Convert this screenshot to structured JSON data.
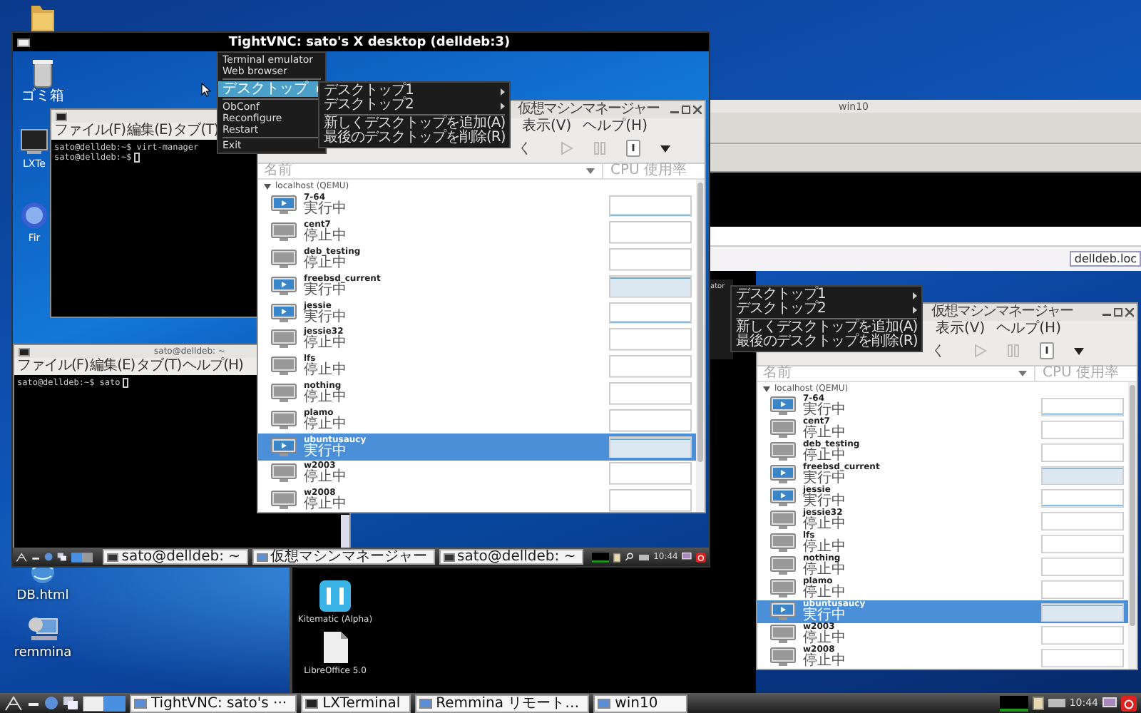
{
  "desktop_icons": [
    {
      "kind": "folder"
    },
    {
      "kind": "web",
      "label": "DB.html"
    },
    {
      "kind": "remote",
      "label": "remmina"
    }
  ],
  "win10_window": {
    "title": "win10",
    "address": "delldeb.loc"
  },
  "remote_view": {
    "icons": [
      {
        "kind": "kitematic",
        "label": "Kitematic (Alpha)"
      },
      {
        "kind": "document",
        "label": "LibreOffice 5.0"
      }
    ],
    "menu_fragment": "ator",
    "submenu": [
      {
        "kind": "submenu",
        "label": "デスクトップ1"
      },
      {
        "kind": "submenu",
        "label": "デスクトップ2"
      },
      {
        "kind": "separator"
      },
      {
        "kind": "item",
        "label": "新しくデスクトップを追加(A)"
      },
      {
        "kind": "item",
        "label": "最後のデスクトップを削除(R)"
      }
    ]
  },
  "vm_windows": [
    {
      "title": "仮想マシンマネージャー",
      "menu": [
        "表示(V)",
        "ヘルプ(H)"
      ],
      "toolbar_fragment": "く",
      "columns": [
        "名前",
        "CPU 使用率"
      ],
      "host": "localhost (QEMU)",
      "rows": [
        {
          "name": "7-64",
          "status": "実行中",
          "running": true,
          "kind": "line",
          "selected": false
        },
        {
          "name": "cent7",
          "status": "停止中",
          "running": false,
          "kind": "empty",
          "selected": false
        },
        {
          "name": "deb_testing",
          "status": "停止中",
          "running": false,
          "kind": "empty",
          "selected": false
        },
        {
          "name": "freebsd_current",
          "status": "実行中",
          "running": true,
          "kind": "filled",
          "selected": false
        },
        {
          "name": "jessie",
          "status": "実行中",
          "running": true,
          "kind": "line",
          "selected": false
        },
        {
          "name": "jessie32",
          "status": "停止中",
          "running": false,
          "kind": "empty",
          "selected": false
        },
        {
          "name": "lfs",
          "status": "停止中",
          "running": false,
          "kind": "empty",
          "selected": false
        },
        {
          "name": "nothing",
          "status": "停止中",
          "running": false,
          "kind": "empty",
          "selected": false
        },
        {
          "name": "plamo",
          "status": "停止中",
          "running": false,
          "kind": "empty",
          "selected": false
        },
        {
          "name": "ubuntusaucy",
          "status": "実行中",
          "running": true,
          "kind": "filled",
          "selected": true
        },
        {
          "name": "w2003",
          "status": "停止中",
          "running": false,
          "kind": "empty",
          "selected": false
        },
        {
          "name": "w2008",
          "status": "停止中",
          "running": false,
          "kind": "empty",
          "selected": false
        }
      ]
    },
    {
      "title": "仮想マシンマネージャー",
      "menu": [
        "表示(V)",
        "ヘルプ(H)"
      ],
      "toolbar_fragment": "く",
      "columns": [
        "名前",
        "CPU 使用率"
      ],
      "host": "localhost (QEMU)",
      "rows": [
        {
          "name": "7-64",
          "status": "実行中",
          "running": true,
          "kind": "line",
          "selected": false
        },
        {
          "name": "cent7",
          "status": "停止中",
          "running": false,
          "kind": "empty",
          "selected": false
        },
        {
          "name": "deb_testing",
          "status": "停止中",
          "running": false,
          "kind": "empty",
          "selected": false
        },
        {
          "name": "freebsd_current",
          "status": "実行中",
          "running": true,
          "kind": "filled",
          "selected": false
        },
        {
          "name": "jessie",
          "status": "実行中",
          "running": true,
          "kind": "line",
          "selected": false
        },
        {
          "name": "jessie32",
          "status": "停止中",
          "running": false,
          "kind": "empty",
          "selected": false
        },
        {
          "name": "lfs",
          "status": "停止中",
          "running": false,
          "kind": "empty",
          "selected": false
        },
        {
          "name": "nothing",
          "status": "停止中",
          "running": false,
          "kind": "empty",
          "selected": false
        },
        {
          "name": "plamo",
          "status": "停止中",
          "running": false,
          "kind": "empty",
          "selected": false
        },
        {
          "name": "ubuntusaucy",
          "status": "実行中",
          "running": true,
          "kind": "filled",
          "selected": true
        },
        {
          "name": "w2003",
          "status": "停止中",
          "running": false,
          "kind": "empty",
          "selected": false
        },
        {
          "name": "w2008",
          "status": "停止中",
          "running": false,
          "kind": "empty",
          "selected": false
        }
      ]
    }
  ],
  "vnc_window": {
    "title": "TightVNC: sato's X desktop (delldeb:3)",
    "desktop_icons": [
      {
        "kind": "trash",
        "label": "ゴミ箱"
      },
      {
        "kind": "terminal",
        "label": "LXTe"
      },
      {
        "kind": "browser",
        "label": "Fir"
      }
    ],
    "terminals": [
      {
        "menu": [
          "ファイル(F)",
          "編集(E)",
          "タブ(T)"
        ],
        "lines": [
          "sato@delldeb:~$ virt-manager",
          "sato@delldeb:~$"
        ]
      },
      {
        "title": "sato@delldeb: ~",
        "menu": [
          "ファイル(F)",
          "編集(E)",
          "タブ(T)",
          "ヘルプ(H)"
        ],
        "lines": [
          "sato@delldeb:~$ sato"
        ]
      }
    ],
    "menu": [
      {
        "kind": "item",
        "label": "Terminal emulator",
        "selected": false
      },
      {
        "kind": "item",
        "label": "Web browser",
        "selected": false
      },
      {
        "kind": "separator"
      },
      {
        "kind": "submenu",
        "label": "デスクトップ",
        "selected": true
      },
      {
        "kind": "separator"
      },
      {
        "kind": "item",
        "label": "ObConf",
        "selected": false
      },
      {
        "kind": "item",
        "label": "Reconfigure",
        "selected": false
      },
      {
        "kind": "item",
        "label": "Restart",
        "selected": false
      },
      {
        "kind": "separator"
      },
      {
        "kind": "item",
        "label": "Exit",
        "selected": false
      }
    ],
    "submenu": [
      {
        "kind": "submenu",
        "label": "デスクトップ1"
      },
      {
        "kind": "submenu",
        "label": "デスクトップ2"
      },
      {
        "kind": "separator"
      },
      {
        "kind": "item",
        "label": "新しくデスクトップを追加(A)"
      },
      {
        "kind": "item",
        "label": "最後のデスクトップを削除(R)"
      }
    ],
    "panel": {
      "tasks": [
        {
          "kind": "terminal",
          "label": "sato@delldeb: ~"
        },
        {
          "kind": "vm",
          "label": "仮想マシンマネージャー"
        },
        {
          "kind": "terminal",
          "label": "sato@delldeb: ~"
        }
      ],
      "clock": "10:44"
    }
  },
  "taskbar": {
    "tasks": [
      {
        "kind": "vnc",
        "label": "TightVNC: sato's ···"
      },
      {
        "kind": "terminal",
        "label": "LXTerminal"
      },
      {
        "kind": "remote",
        "label": "Remmina リモート…"
      },
      {
        "kind": "remote",
        "label": "win10"
      }
    ],
    "clock": "10:44"
  }
}
